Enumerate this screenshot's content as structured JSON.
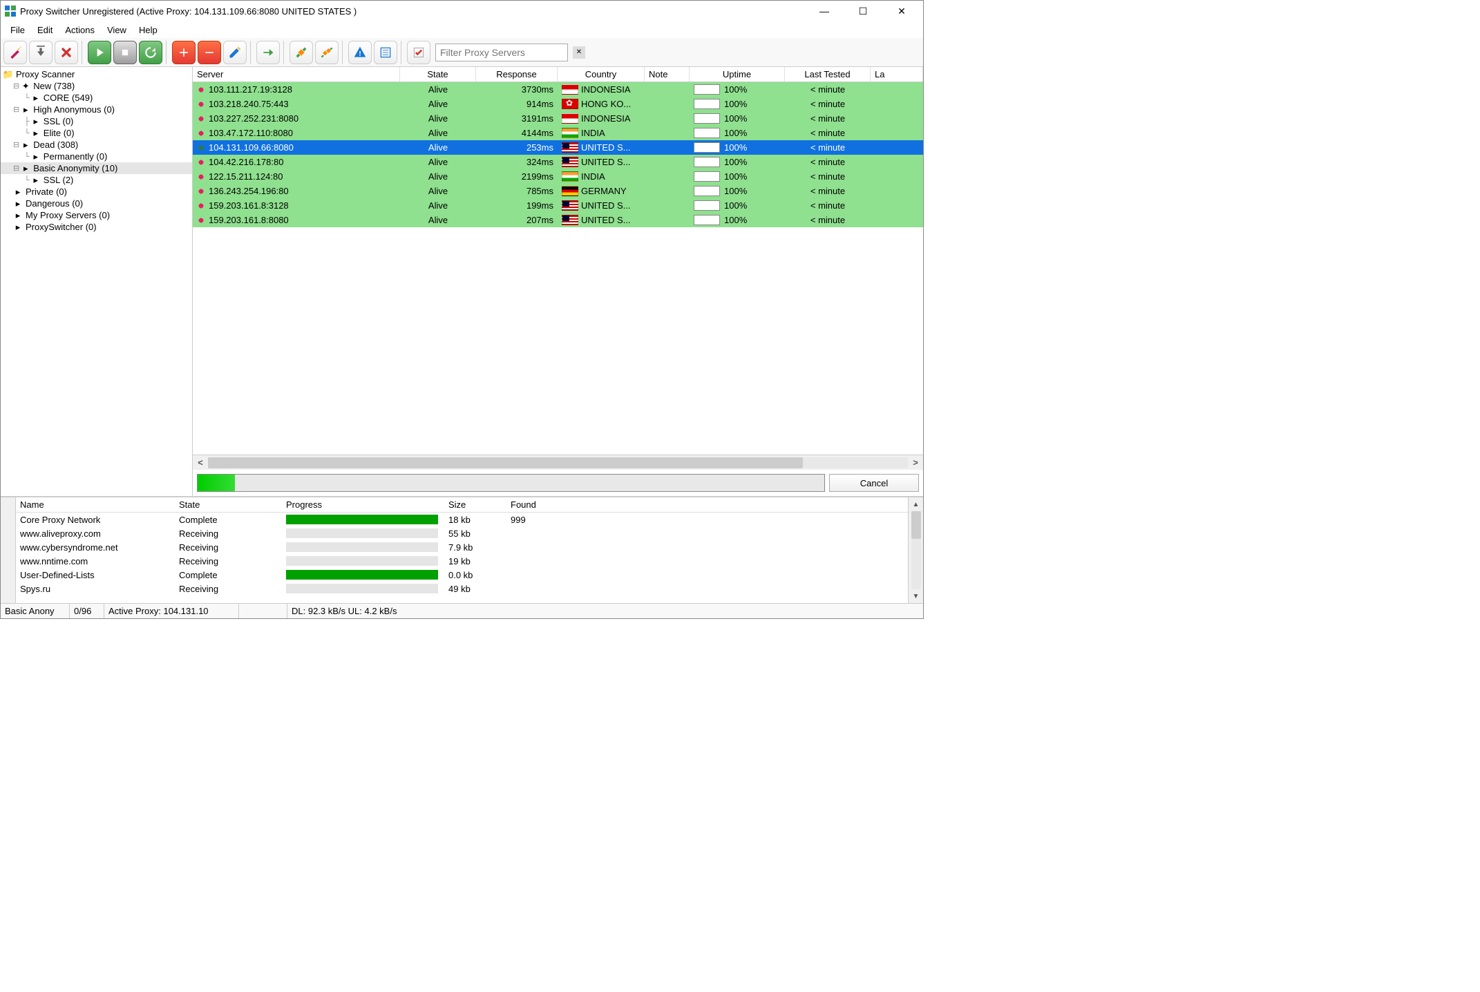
{
  "title": "Proxy Switcher Unregistered (Active Proxy: 104.131.109.66:8080 UNITED STATES )",
  "menu": {
    "file": "File",
    "edit": "Edit",
    "actions": "Actions",
    "view": "View",
    "help": "Help"
  },
  "filter": {
    "placeholder": "Filter Proxy Servers"
  },
  "tree": {
    "root": "Proxy Scanner",
    "new": "New (738)",
    "core": "CORE (549)",
    "ha": "High Anonymous (0)",
    "ssl1": "SSL (0)",
    "elite": "Elite (0)",
    "dead": "Dead (308)",
    "perm": "Permanently (0)",
    "basic": "Basic Anonymity (10)",
    "ssl2": "SSL (2)",
    "priv": "Private (0)",
    "dang": "Dangerous (0)",
    "myps": "My Proxy Servers (0)",
    "psw": "ProxySwitcher (0)"
  },
  "cols": {
    "server": "Server",
    "state": "State",
    "resp": "Response",
    "country": "Country",
    "note": "Note",
    "uptime": "Uptime",
    "last": "Last Tested",
    "la": "La"
  },
  "rows": [
    {
      "server": "103.111.217.19:3128",
      "state": "Alive",
      "resp": "3730ms",
      "country": "INDONESIA",
      "flag": "id",
      "uptime": "100%",
      "last": "< minute",
      "sel": false,
      "g": true
    },
    {
      "server": "103.218.240.75:443",
      "state": "Alive",
      "resp": "914ms",
      "country": "HONG KO...",
      "flag": "hk",
      "uptime": "100%",
      "last": "< minute",
      "sel": false,
      "g": true
    },
    {
      "server": "103.227.252.231:8080",
      "state": "Alive",
      "resp": "3191ms",
      "country": "INDONESIA",
      "flag": "id",
      "uptime": "100%",
      "last": "< minute",
      "sel": false,
      "g": true
    },
    {
      "server": "103.47.172.110:8080",
      "state": "Alive",
      "resp": "4144ms",
      "country": "INDIA",
      "flag": "in",
      "uptime": "100%",
      "last": "< minute",
      "sel": false,
      "g": true
    },
    {
      "server": "104.131.109.66:8080",
      "state": "Alive",
      "resp": "253ms",
      "country": "UNITED S...",
      "flag": "us",
      "uptime": "100%",
      "last": "< minute",
      "sel": true,
      "g": false
    },
    {
      "server": "104.42.216.178:80",
      "state": "Alive",
      "resp": "324ms",
      "country": "UNITED S...",
      "flag": "us",
      "uptime": "100%",
      "last": "< minute",
      "sel": false,
      "g": true
    },
    {
      "server": "122.15.211.124:80",
      "state": "Alive",
      "resp": "2199ms",
      "country": "INDIA",
      "flag": "in",
      "uptime": "100%",
      "last": "< minute",
      "sel": false,
      "g": true
    },
    {
      "server": "136.243.254.196:80",
      "state": "Alive",
      "resp": "785ms",
      "country": "GERMANY",
      "flag": "de",
      "uptime": "100%",
      "last": "< minute",
      "sel": false,
      "g": true
    },
    {
      "server": "159.203.161.8:3128",
      "state": "Alive",
      "resp": "199ms",
      "country": "UNITED S...",
      "flag": "us",
      "uptime": "100%",
      "last": "< minute",
      "sel": false,
      "g": true
    },
    {
      "server": "159.203.161.8:8080",
      "state": "Alive",
      "resp": "207ms",
      "country": "UNITED S...",
      "flag": "us",
      "uptime": "100%",
      "last": "< minute",
      "sel": false,
      "g": true
    }
  ],
  "cancel": "Cancel",
  "bcols": {
    "name": "Name",
    "state": "State",
    "prog": "Progress",
    "size": "Size",
    "found": "Found"
  },
  "brows": [
    {
      "name": "Core Proxy Network",
      "state": "Complete",
      "prog": 100,
      "size": "18 kb",
      "found": "999"
    },
    {
      "name": "www.aliveproxy.com",
      "state": "Receiving",
      "prog": 0,
      "size": "55 kb",
      "found": ""
    },
    {
      "name": "www.cybersyndrome.net",
      "state": "Receiving",
      "prog": 0,
      "size": "7.9 kb",
      "found": ""
    },
    {
      "name": "www.nntime.com",
      "state": "Receiving",
      "prog": 0,
      "size": "19 kb",
      "found": ""
    },
    {
      "name": "User-Defined-Lists",
      "state": "Complete",
      "prog": 100,
      "size": "0.0 kb",
      "found": ""
    },
    {
      "name": "Spys.ru",
      "state": "Receiving",
      "prog": 0,
      "size": "49 kb",
      "found": ""
    }
  ],
  "status": {
    "s1": "Basic Anony",
    "s2": "0/96",
    "s3": "Active Proxy: 104.131.10",
    "s4": "DL: 92.3 kB/s UL: 4.2 kB/s"
  }
}
